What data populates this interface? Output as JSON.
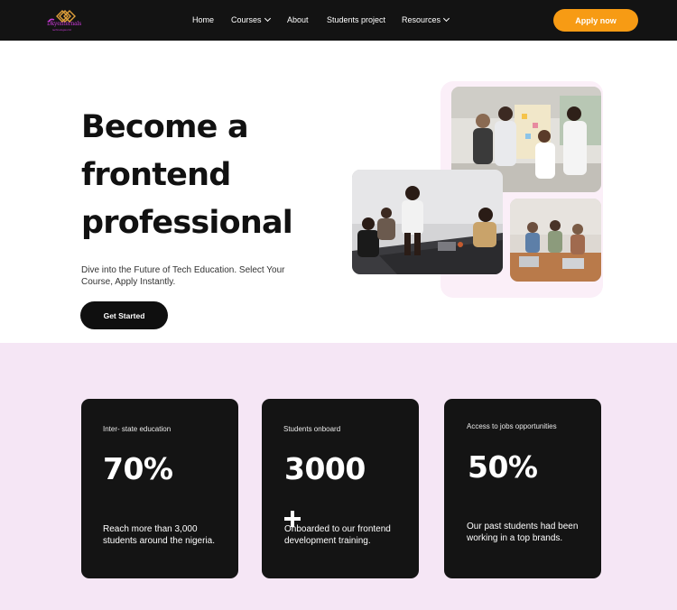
{
  "nav": {
    "logo": {
      "text": "Dkyenternals",
      "subtext": "technologies ltd",
      "icon": "diamond-lattice-logo"
    },
    "items": [
      {
        "label": "Home",
        "has_dropdown": false
      },
      {
        "label": "Courses",
        "has_dropdown": true
      },
      {
        "label": "About",
        "has_dropdown": false
      },
      {
        "label": "Students project",
        "has_dropdown": false
      },
      {
        "label": "Resources",
        "has_dropdown": true
      }
    ],
    "apply_label": "Apply now"
  },
  "hero": {
    "title_lines": [
      "Become a",
      "frontend",
      "professional"
    ],
    "subtitle": "Dive into the Future of Tech Education. Select Your Course, Apply Instantly.",
    "cta_label": "Get Started",
    "images": [
      {
        "icon": "team-meeting-photo"
      },
      {
        "icon": "presentation-photo"
      },
      {
        "icon": "classroom-photo"
      }
    ]
  },
  "stats": [
    {
      "label": "Inter- state education",
      "value": "70%",
      "description": "Reach more than 3,000 students around the nigeria."
    },
    {
      "label": "Students onboard",
      "value": "3000",
      "plus_icon": "plus-icon",
      "description": "Onboarded to our frontend development training."
    },
    {
      "label": "Access to jobs opportunities",
      "value": "50%",
      "description": "Our past students had been working in a top brands."
    }
  ],
  "colors": {
    "nav_bg": "#131313",
    "accent": "#f79b14",
    "stats_bg": "#f5e6f5",
    "card_bg": "#141414",
    "logo": "#c83ad6"
  }
}
